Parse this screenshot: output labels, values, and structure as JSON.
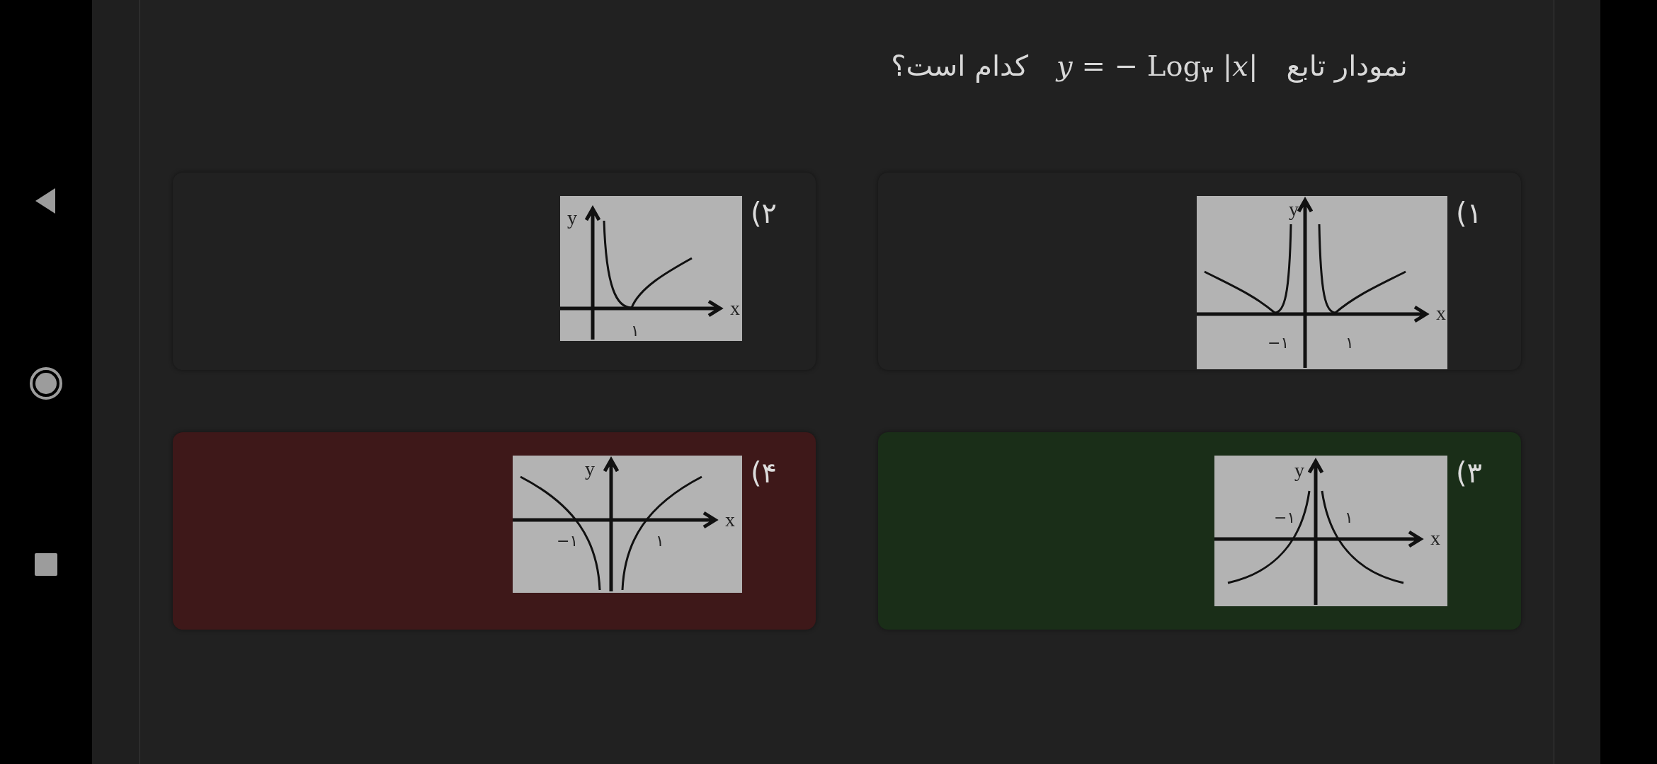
{
  "nav_bar": {
    "buttons": [
      {
        "kind": "back"
      },
      {
        "kind": "home"
      },
      {
        "kind": "recents"
      }
    ]
  },
  "question": {
    "prefix": "نمودار تابع",
    "formula": "*y* = − Log$_{۳}$ |*x*|",
    "suffix": "کدام است؟"
  },
  "options": [
    {
      "label": "۱)",
      "selected": false,
      "correct": false,
      "graph": {
        "kind": "abs-log-cusp",
        "y_label": "y",
        "x_label": "x",
        "ticks": [
          "۱",
          "−۱"
        ]
      }
    },
    {
      "label": "۲)",
      "selected": false,
      "correct": false,
      "graph": {
        "kind": "log-cusp-right",
        "y_label": "y",
        "x_label": "x",
        "ticks": [
          "۱"
        ]
      }
    },
    {
      "label": "۳)",
      "selected": false,
      "correct": true,
      "graph": {
        "kind": "neg-abs-log",
        "y_label": "y",
        "x_label": "x",
        "ticks": [
          "۱",
          "−۱"
        ]
      }
    },
    {
      "label": "۴)",
      "selected": true,
      "correct": false,
      "graph": {
        "kind": "abs-log",
        "y_label": "y",
        "x_label": "x",
        "ticks": [
          "۱",
          "−۱"
        ]
      }
    }
  ]
}
